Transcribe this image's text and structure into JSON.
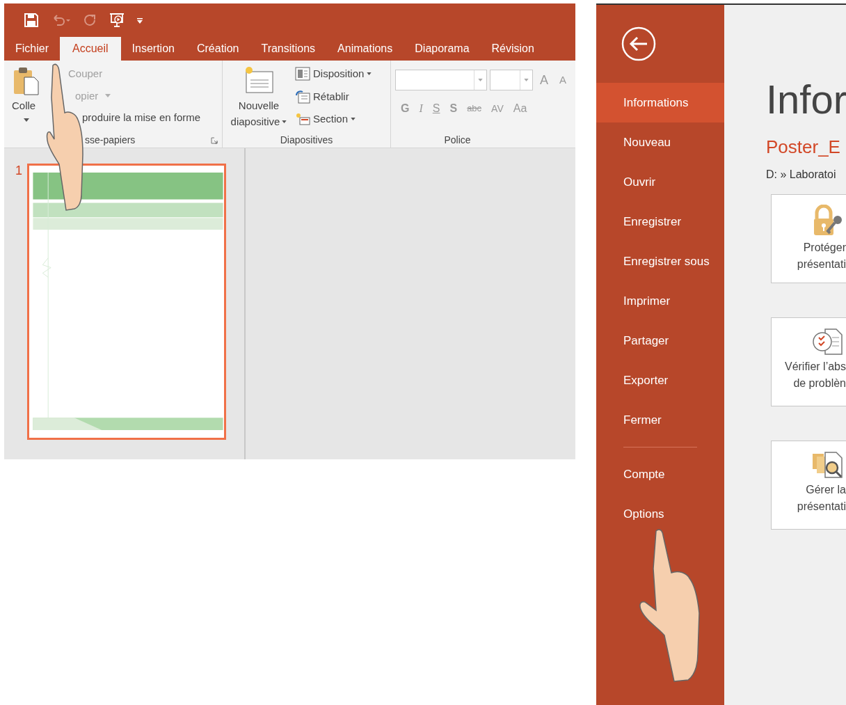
{
  "ribbon_tabs": [
    {
      "label": "Fichier",
      "selected": false
    },
    {
      "label": "Accueil",
      "selected": true
    },
    {
      "label": "Insertion",
      "selected": false
    },
    {
      "label": "Création",
      "selected": false
    },
    {
      "label": "Transitions",
      "selected": false
    },
    {
      "label": "Animations",
      "selected": false
    },
    {
      "label": "Diaporama",
      "selected": false
    },
    {
      "label": "Révision",
      "selected": false
    }
  ],
  "clipboard": {
    "paste": "Colle",
    "cut": "Couper",
    "copy": "opier",
    "format_painter": "produire la mise en forme",
    "group": "sse-papiers"
  },
  "slides_group": {
    "new_slide": [
      "Nouvelle",
      "diapositive"
    ],
    "layout": "Disposition",
    "reset": "Rétablir",
    "section": "Section",
    "group": "Diapositives"
  },
  "font_group": {
    "grow": "A",
    "shrink": "A",
    "buttons": [
      "G",
      "I",
      "S",
      "S",
      "abc",
      "AV",
      "Aa"
    ],
    "group": "Police"
  },
  "slide_panel": {
    "number": "1",
    "selected": true
  },
  "backstage": {
    "menu": [
      {
        "label": "Informations",
        "selected": true
      },
      {
        "label": "Nouveau",
        "selected": false
      },
      {
        "label": "Ouvrir",
        "selected": false
      },
      {
        "label": "Enregistrer",
        "selected": false
      },
      {
        "label": "Enregistrer sous",
        "selected": false
      },
      {
        "label": "Imprimer",
        "selected": false
      },
      {
        "label": "Partager",
        "selected": false
      },
      {
        "label": "Exporter",
        "selected": false
      },
      {
        "label": "Fermer",
        "selected": false
      }
    ],
    "menu_bottom": [
      {
        "label": "Compte",
        "selected": false
      },
      {
        "label": "Options",
        "selected": false
      }
    ],
    "title": "Infor",
    "file_name": "Poster_E",
    "path": "D: » Laboratoi",
    "cards": [
      {
        "kind": "protect",
        "lines": [
          "Protéger",
          "présentati"
        ]
      },
      {
        "kind": "inspect",
        "lines": [
          "Vérifier l’abs",
          "de problèn"
        ]
      },
      {
        "kind": "manage",
        "lines": [
          "Gérer la",
          "présentati"
        ]
      }
    ]
  }
}
